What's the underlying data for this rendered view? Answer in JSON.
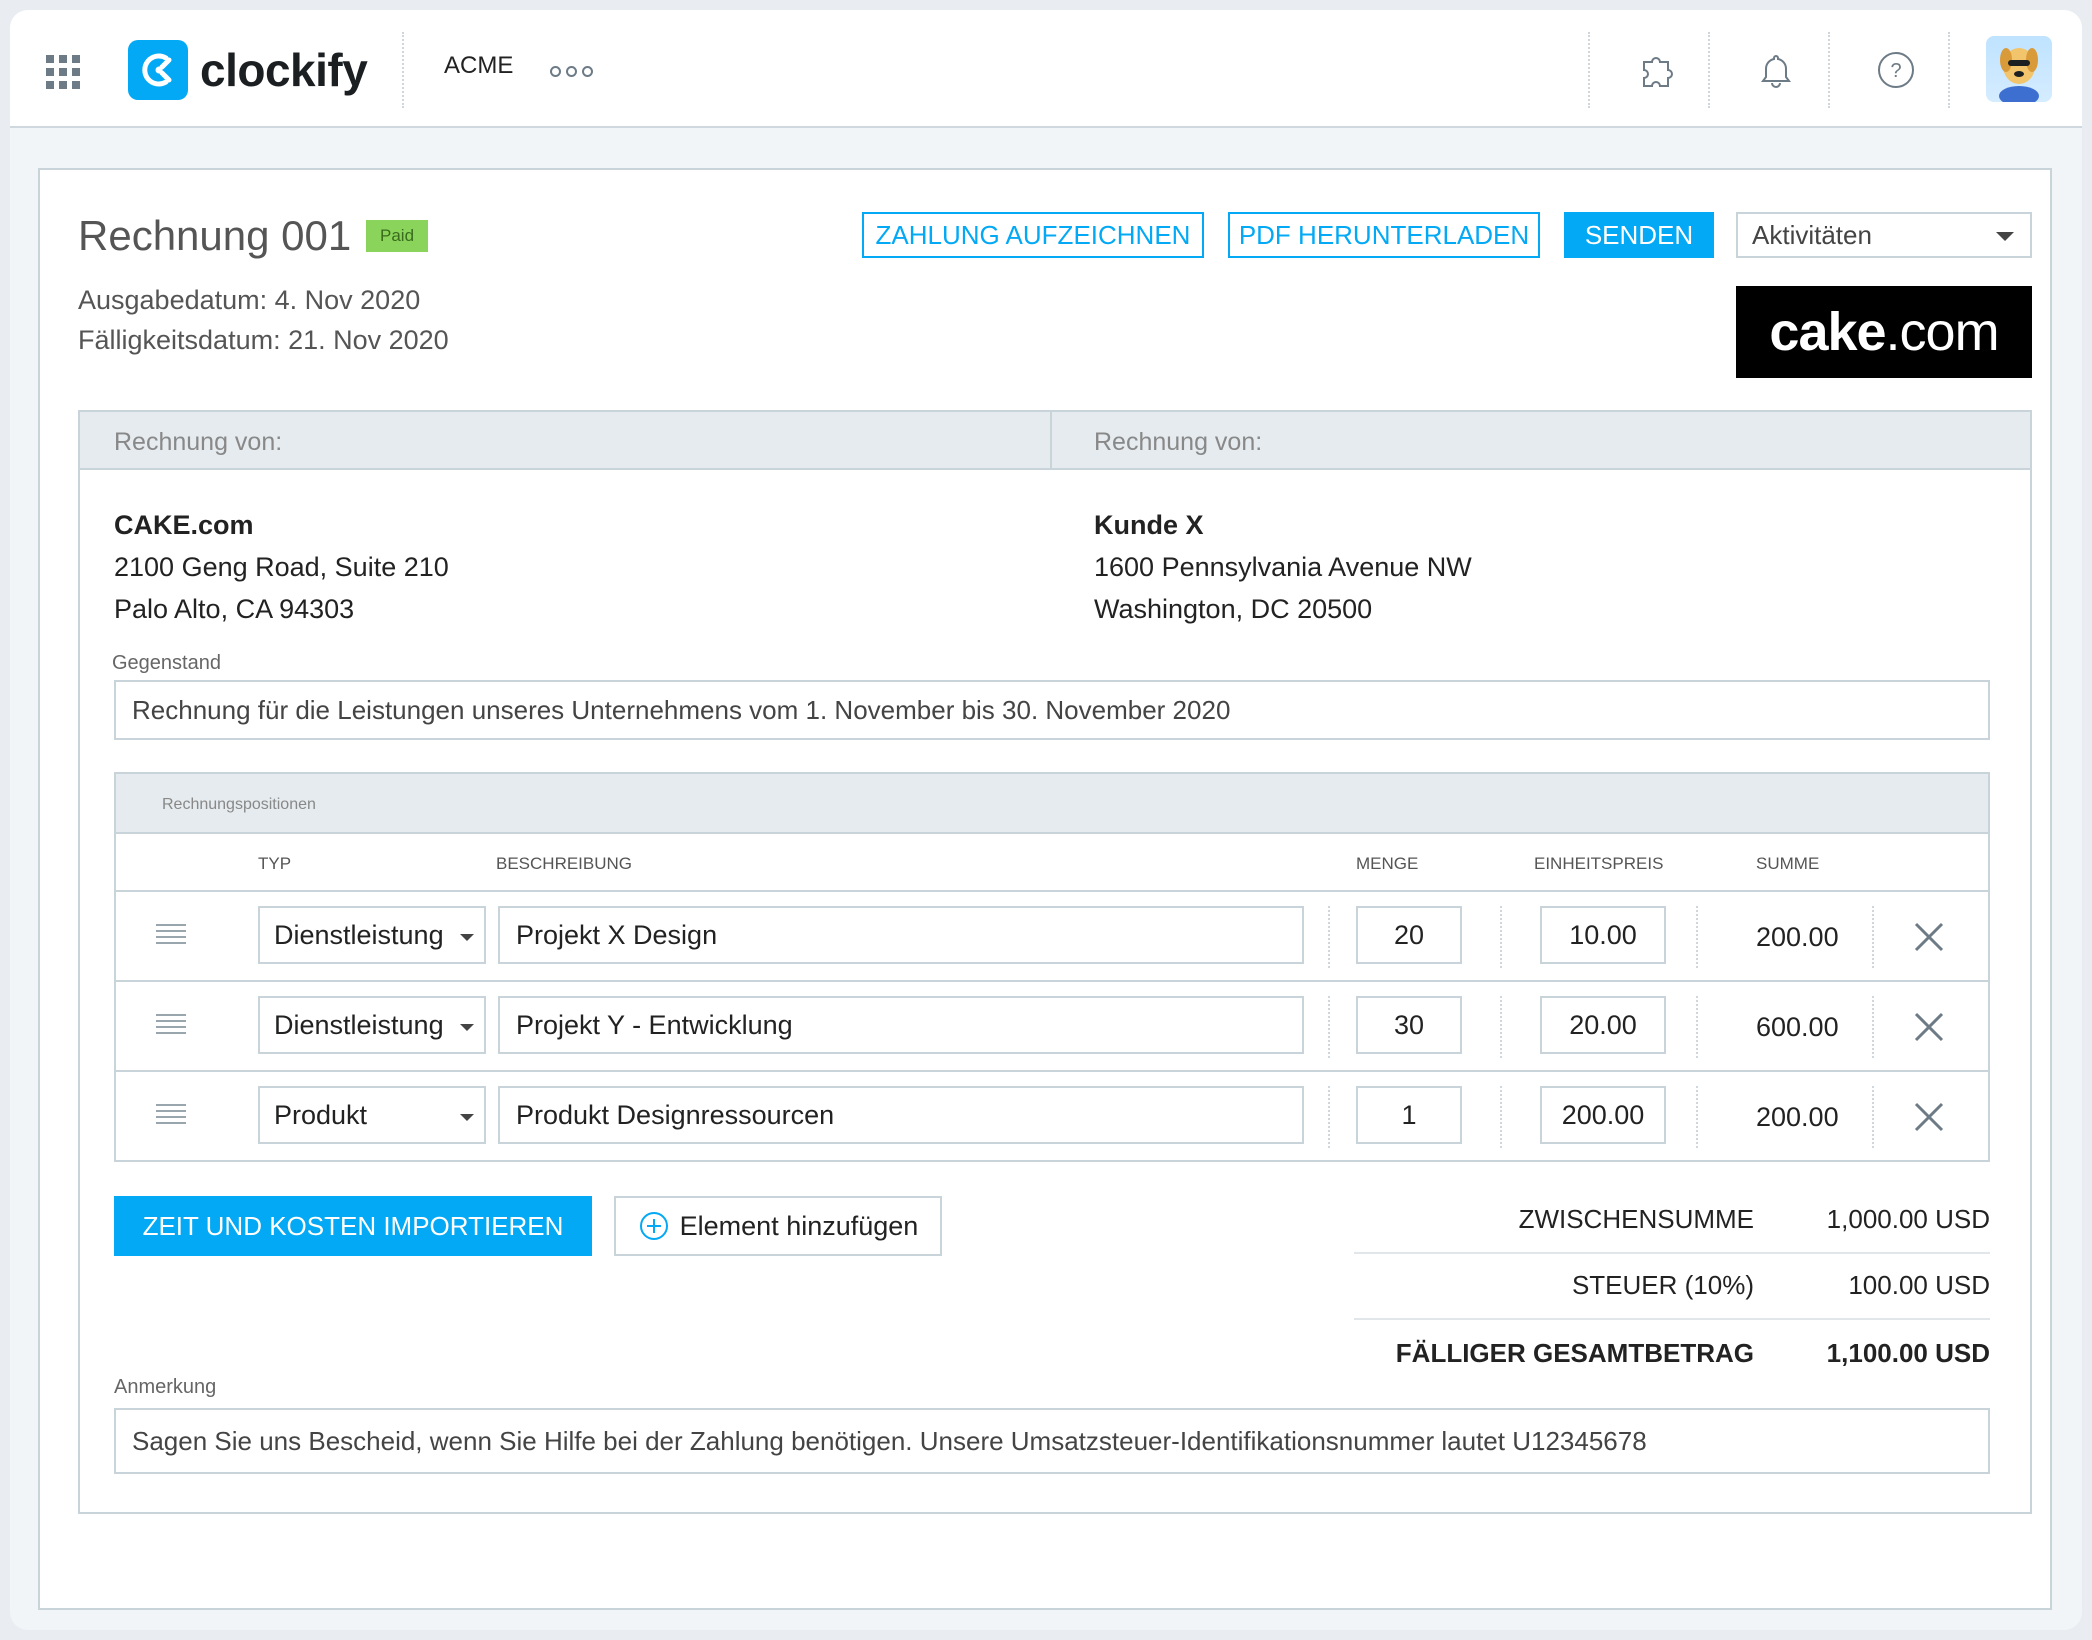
{
  "topbar": {
    "brand": "clockify",
    "workspace": "ACME"
  },
  "invoice": {
    "title": "Rechnung 001",
    "status": "Paid",
    "issue_date": "Ausgabedatum: 4. Nov 2020",
    "due_date": "Fälligkeitsdatum: 21. Nov 2020",
    "actions": {
      "record_payment": "ZAHLUNG AUFZEICHNEN",
      "download_pdf": "PDF HERUNTERLADEN",
      "send": "SENDEN",
      "activities": "Aktivitäten"
    },
    "company_logo": {
      "bold": "cake",
      "rest": ".com"
    }
  },
  "billing": {
    "from_label": "Rechnung von:",
    "to_label": "Rechnung von:",
    "from": {
      "name": "CAKE.com",
      "line1": "2100 Geng Road, Suite 210",
      "line2": "Palo Alto, CA 94303"
    },
    "to": {
      "name": "Kunde X",
      "line1": "1600 Pennsylvania Avenue NW",
      "line2": "Washington, DC 20500"
    }
  },
  "subject": {
    "label": "Gegenstand",
    "value": "Rechnung für die Leistungen unseres Unternehmens vom 1. November bis 30. November 2020"
  },
  "items": {
    "section_label": "Rechnungspositionen",
    "columns": {
      "type": "TYP",
      "description": "BESCHREIBUNG",
      "quantity": "MENGE",
      "unit_price": "EINHEITSPREIS",
      "sum": "SUMME"
    },
    "rows": [
      {
        "type": "Dienstleistung",
        "description": "Projekt X Design",
        "quantity": "20",
        "unit_price": "10.00",
        "sum": "200.00"
      },
      {
        "type": "Dienstleistung",
        "description": "Projekt Y - Entwicklung",
        "quantity": "30",
        "unit_price": "20.00",
        "sum": "600.00"
      },
      {
        "type": "Produkt",
        "description": "Produkt  Designressourcen",
        "quantity": "1",
        "unit_price": "200.00",
        "sum": "200.00"
      }
    ]
  },
  "buttons": {
    "import": "ZEIT UND KOSTEN  IMPORTIEREN",
    "add_item": "Element hinzufügen"
  },
  "totals": {
    "subtotal_label": "ZWISCHENSUMME",
    "subtotal_value": "1,000.00 USD",
    "tax_label": "STEUER  (10%)",
    "tax_value": "100.00 USD",
    "due_label": "FÄLLIGER GESAMTBETRAG",
    "due_value": "1,100.00 USD"
  },
  "note": {
    "label": "Anmerkung",
    "value": "Sagen Sie uns Bescheid, wenn Sie Hilfe bei der Zahlung benötigen. Unsere Umsatzsteuer-Identifikationsnummer lautet U12345678"
  },
  "colors": {
    "accent": "#03a9f4",
    "paid_badge": "#8bd45b",
    "panel_header": "#e6ebef",
    "border": "#c9d3da"
  }
}
